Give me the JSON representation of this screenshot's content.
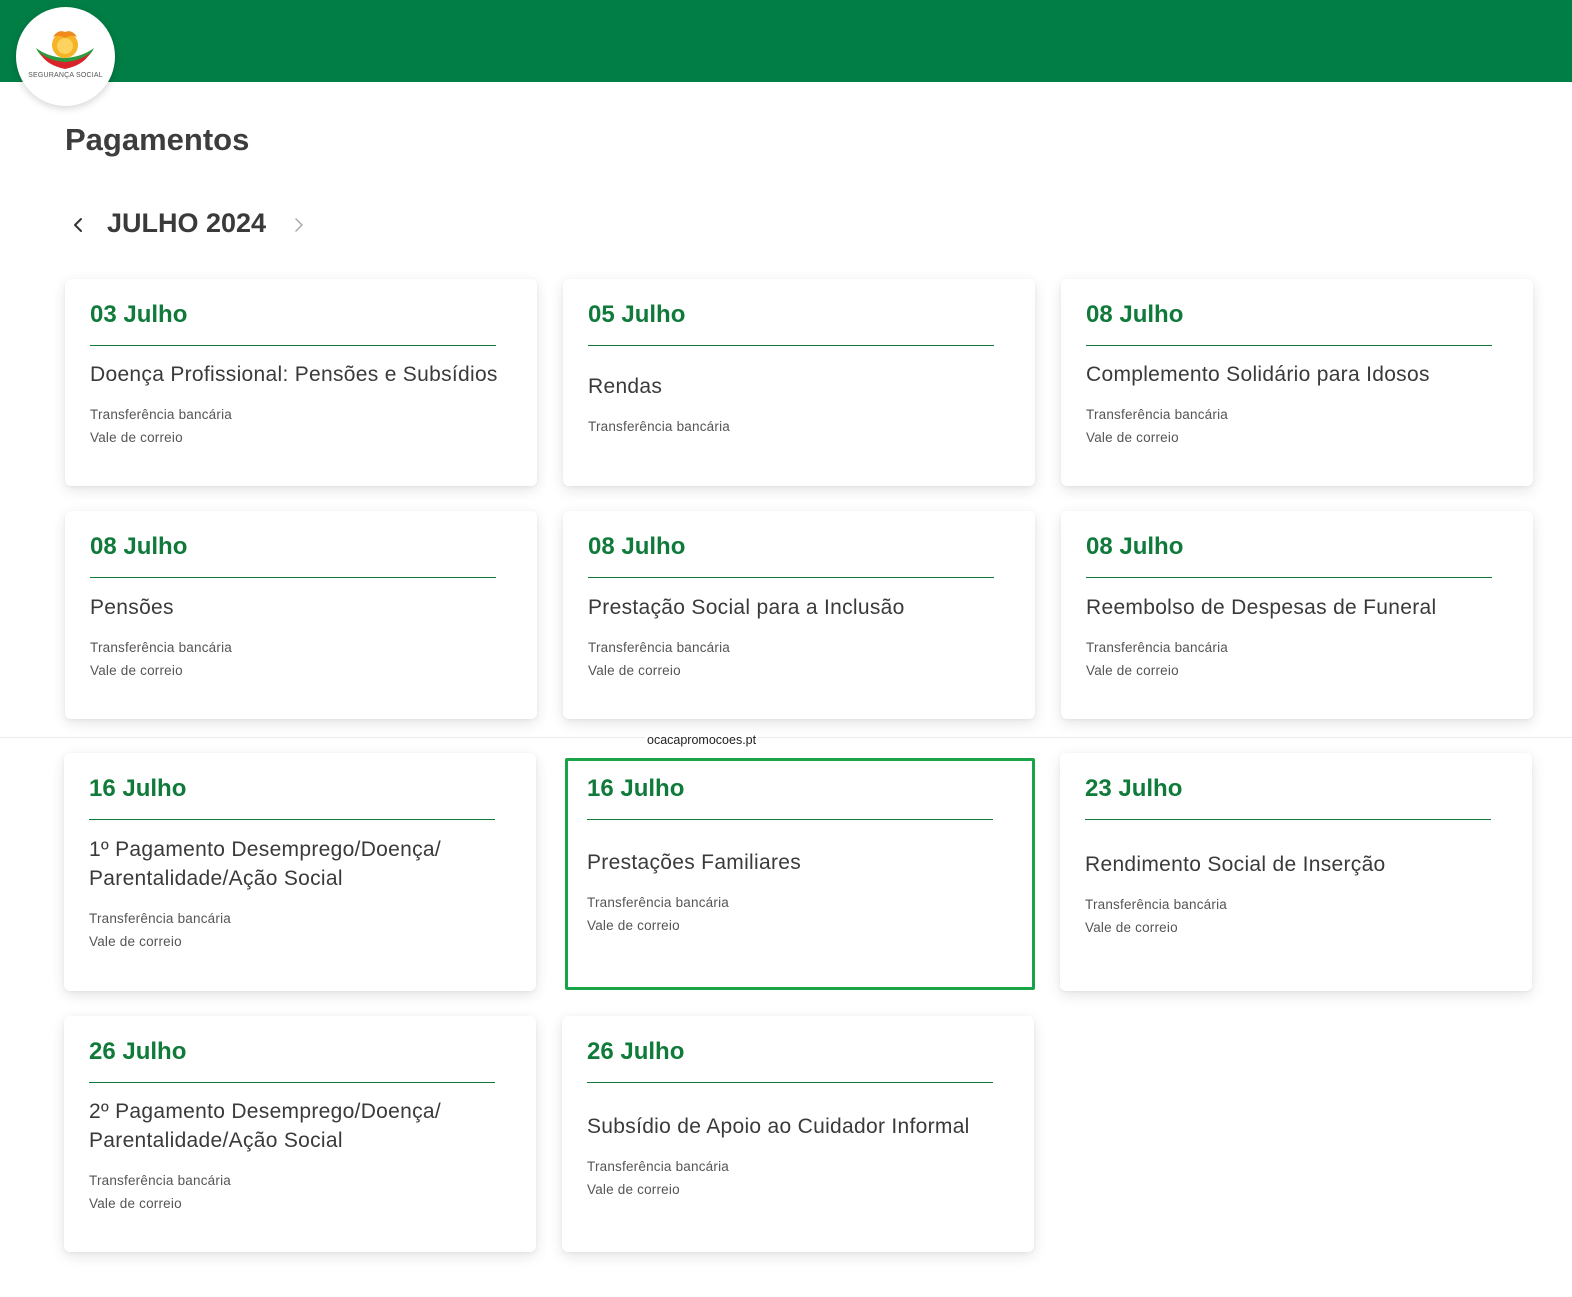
{
  "header": {
    "logo_text": "SEGURANÇA SOCIAL",
    "brand_color": "#007e45"
  },
  "page": {
    "title": "Pagamentos"
  },
  "month_nav": {
    "prev_icon": "chevron-left-icon",
    "label": "JULHO 2024",
    "next_icon": "chevron-right-icon"
  },
  "watermark": "ocacapromocoes.pt",
  "cards": [
    {
      "date": "03 Julho",
      "title": "Doença Profissional: Pensões e Subsídios",
      "methods": [
        "Transferência bancária",
        "Vale de correio"
      ]
    },
    {
      "date": "05 Julho",
      "title": "Rendas",
      "methods": [
        "Transferência bancária"
      ]
    },
    {
      "date": "08 Julho",
      "title": "Complemento Solidário para Idosos",
      "methods": [
        "Transferência bancária",
        "Vale de correio"
      ]
    },
    {
      "date": "08 Julho",
      "title": "Pensões",
      "methods": [
        "Transferência bancária",
        "Vale de correio"
      ]
    },
    {
      "date": "08 Julho",
      "title": "Prestação Social para a Inclusão",
      "methods": [
        "Transferência bancária",
        "Vale de correio"
      ]
    },
    {
      "date": "08 Julho",
      "title": "Reembolso de Despesas de Funeral",
      "methods": [
        "Transferência bancária",
        "Vale de correio"
      ]
    },
    {
      "date": "16 Julho",
      "title": "1º Pagamento Desemprego/Doença/ Parentalidade/Ação Social",
      "methods": [
        "Transferência bancária",
        "Vale de correio"
      ]
    },
    {
      "date": "16 Julho",
      "title": "Prestações Familiares",
      "methods": [
        "Transferência bancária",
        "Vale de correio"
      ],
      "highlighted": true
    },
    {
      "date": "23 Julho",
      "title": "Rendimento Social de Inserção",
      "methods": [
        "Transferência bancária",
        "Vale de correio"
      ]
    },
    {
      "date": "26 Julho",
      "title": "2º Pagamento Desemprego/Doença/ Parentalidade/Ação Social",
      "methods": [
        "Transferência bancária",
        "Vale de correio"
      ]
    },
    {
      "date": "26 Julho",
      "title": "Subsídio de Apoio ao Cuidador Informal",
      "methods": [
        "Transferência bancária",
        "Vale de correio"
      ]
    }
  ]
}
